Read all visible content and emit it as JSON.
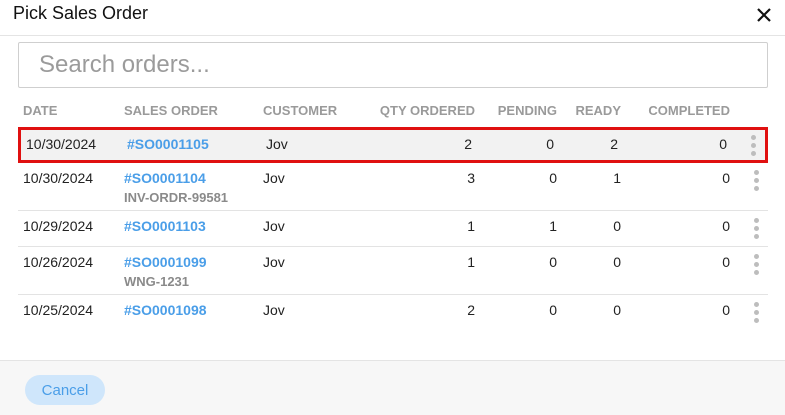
{
  "dialog": {
    "title": "Pick Sales Order"
  },
  "search": {
    "placeholder": "Search orders..."
  },
  "columns": [
    "DATE",
    "SALES ORDER",
    "CUSTOMER",
    "QTY ORDERED",
    "PENDING",
    "READY",
    "COMPLETED"
  ],
  "rows": [
    {
      "date": "10/30/2024",
      "so": "#SO0001105",
      "ref": "",
      "customer": "Jov",
      "qty": "2",
      "pending": "0",
      "ready": "2",
      "completed": "0",
      "selected": true
    },
    {
      "date": "10/30/2024",
      "so": "#SO0001104",
      "ref": "INV-ORDR-99581",
      "customer": "Jov",
      "qty": "3",
      "pending": "0",
      "ready": "1",
      "completed": "0",
      "selected": false
    },
    {
      "date": "10/29/2024",
      "so": "#SO0001103",
      "ref": "",
      "customer": "Jov",
      "qty": "1",
      "pending": "1",
      "ready": "0",
      "completed": "0",
      "selected": false
    },
    {
      "date": "10/26/2024",
      "so": "#SO0001099",
      "ref": "WNG-1231",
      "customer": "Jov",
      "qty": "1",
      "pending": "0",
      "ready": "0",
      "completed": "0",
      "selected": false
    },
    {
      "date": "10/25/2024",
      "so": "#SO0001098",
      "ref": "",
      "customer": "Jov",
      "qty": "2",
      "pending": "0",
      "ready": "0",
      "completed": "0",
      "selected": false
    }
  ],
  "footer": {
    "cancel_label": "Cancel"
  },
  "icons": {
    "close": "close-icon",
    "row_menu": "more-vertical-icon"
  },
  "colors": {
    "link": "#4a9ee8",
    "selection_border": "#e01010",
    "cancel_bg": "#cfe6fb"
  }
}
